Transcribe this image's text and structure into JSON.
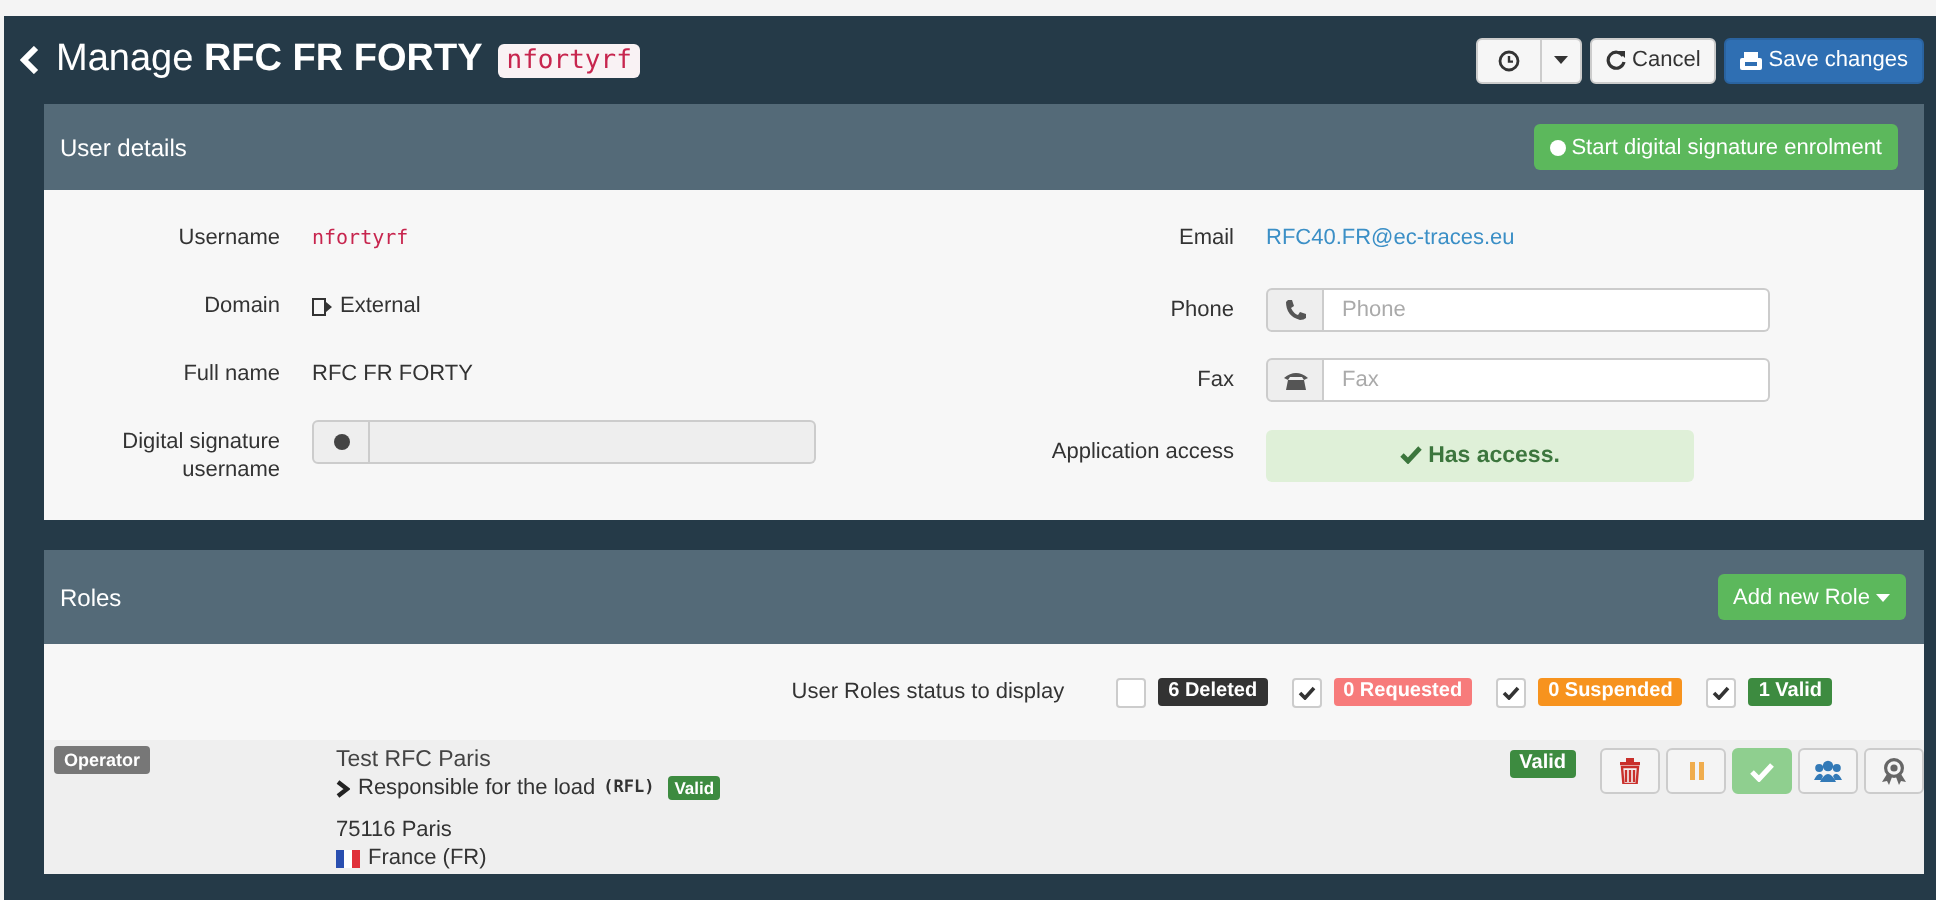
{
  "header": {
    "title": "Manage **RFC FR FORTY**",
    "code": "nfortyrf",
    "cancel": "Cancel",
    "save": "Save changes"
  },
  "user_details": {
    "title": "User details",
    "enrol_button": "Start digital signature enrolment",
    "left": [
      {
        "kind": "code",
        "label": "Username",
        "value": "nfortyrf"
      },
      {
        "kind": "icon-text",
        "label": "Domain",
        "value": "External"
      },
      {
        "kind": "text",
        "label": "Full name",
        "value": "RFC FR FORTY"
      },
      {
        "kind": "signature",
        "label": "Digital signature username"
      }
    ],
    "right": [
      {
        "kind": "link",
        "label": "Email",
        "value": "RFC40.FR@ec-traces.eu"
      },
      {
        "kind": "phone",
        "label": "Phone",
        "placeholder": "Phone"
      },
      {
        "kind": "fax",
        "label": "Fax",
        "placeholder": "Fax"
      },
      {
        "kind": "alert",
        "label": "Application access",
        "value": "Has access."
      }
    ]
  },
  "roles": {
    "title": "Roles",
    "add_button": "Add new Role",
    "filter_label": "User Roles status to display",
    "filters": [
      {
        "label": "6 Deleted",
        "checked": false,
        "color": "#333333"
      },
      {
        "label": "0 Requested",
        "checked": true,
        "color": "#f77b7b"
      },
      {
        "label": "0 Suspended",
        "checked": true,
        "color": "#f7931e"
      },
      {
        "label": "1 Valid",
        "checked": true,
        "color": "#3d8b40"
      }
    ],
    "items": [
      {
        "type": "Operator",
        "name": "Test RFC Paris",
        "responsibility": "Responsible for the load",
        "code": "(RFL)",
        "responsibility_status": "Valid",
        "address": "75116 Paris",
        "country": "France (FR)",
        "status": "Valid",
        "actions": [
          {
            "kind": "delete"
          },
          {
            "kind": "suspend"
          },
          {
            "kind": "validate"
          },
          {
            "kind": "users"
          },
          {
            "kind": "award"
          }
        ]
      }
    ]
  }
}
